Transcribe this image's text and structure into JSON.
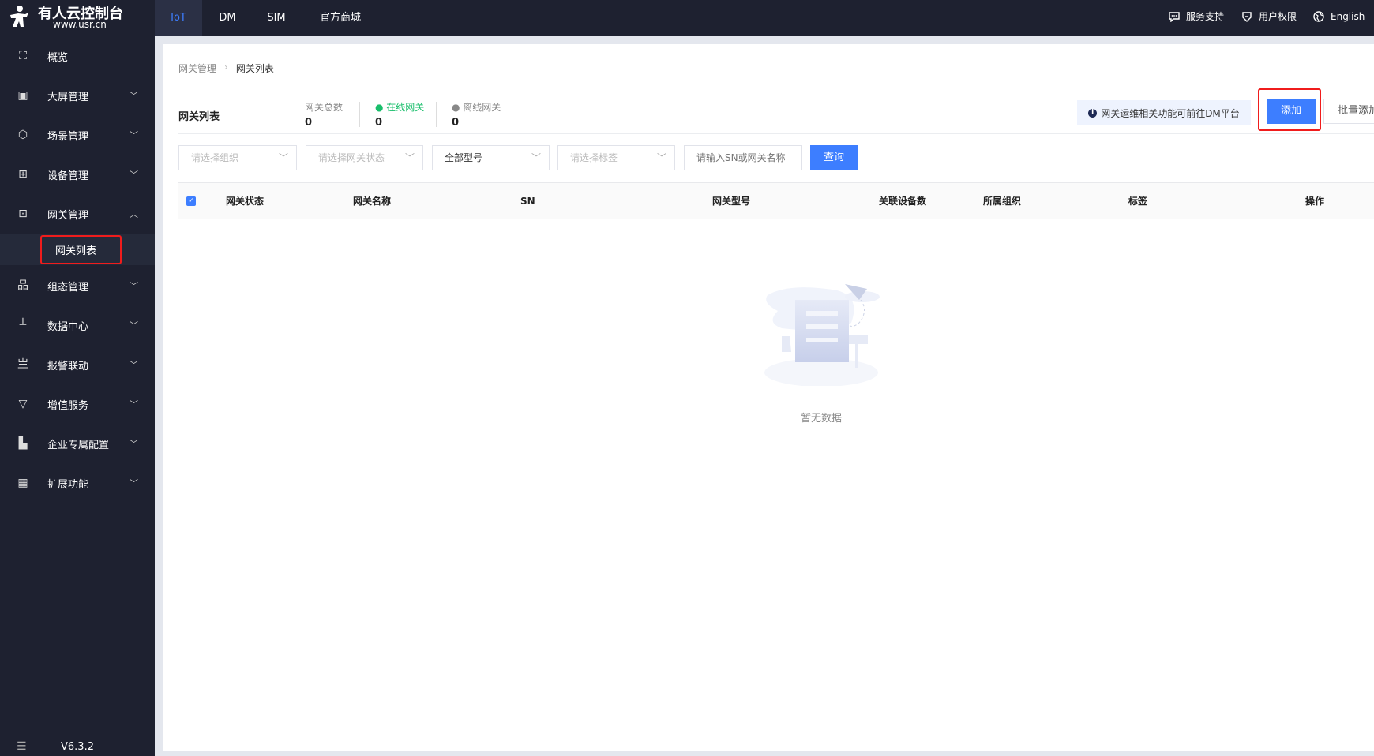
{
  "brand": {
    "title": "有人云控制台",
    "url": "www.usr.cn"
  },
  "top_tabs": [
    {
      "label": "IoT",
      "active": true
    },
    {
      "label": "DM"
    },
    {
      "label": "SIM"
    },
    {
      "label": "官方商城"
    }
  ],
  "header_links": [
    {
      "label": "服务支持",
      "icon": "chat-icon"
    },
    {
      "label": "用户权限",
      "icon": "shield-icon"
    },
    {
      "label": "English",
      "icon": "globe-icon"
    }
  ],
  "sidebar": {
    "items": [
      {
        "label": "概览",
        "icon": "overview-icon"
      },
      {
        "label": "大屏管理",
        "icon": "screen-icon",
        "expandable": true
      },
      {
        "label": "场景管理",
        "icon": "scene-icon",
        "expandable": true
      },
      {
        "label": "设备管理",
        "icon": "device-icon",
        "expandable": true
      },
      {
        "label": "网关管理",
        "icon": "gateway-icon",
        "expandable": true,
        "expanded": true,
        "children": [
          {
            "label": "网关列表",
            "active": true
          }
        ]
      },
      {
        "label": "组态管理",
        "icon": "topology-icon",
        "expandable": true
      },
      {
        "label": "数据中心",
        "icon": "chart-icon",
        "expandable": true
      },
      {
        "label": "报警联动",
        "icon": "alarm-icon",
        "expandable": true
      },
      {
        "label": "增值服务",
        "icon": "diamond-icon",
        "expandable": true
      },
      {
        "label": "企业专属配置",
        "icon": "building-icon",
        "expandable": true
      },
      {
        "label": "扩展功能",
        "icon": "grid-icon",
        "expandable": true
      }
    ],
    "version": "V6.3.2"
  },
  "breadcrumb": [
    "网关管理",
    "网关列表"
  ],
  "page_title": "网关列表",
  "stats": [
    {
      "label": "网关总数",
      "value": "0"
    },
    {
      "label": "在线网关",
      "value": "0",
      "color": "#19be6b"
    },
    {
      "label": "离线网关",
      "value": "0",
      "color": "#999999"
    }
  ],
  "info_banner": "网关运维相关功能可前往DM平台",
  "buttons": {
    "add": "添加",
    "batch_add": "批量添加",
    "query": "查询"
  },
  "filters": {
    "org": "请选择组织",
    "status": "请选择网关状态",
    "model": "全部型号",
    "tag": "请选择标签",
    "search_placeholder": "请输入SN或网关名称"
  },
  "table": {
    "columns": [
      "网关状态",
      "网关名称",
      "SN",
      "网关型号",
      "关联设备数",
      "所属组织",
      "标签",
      "操作"
    ],
    "rows": [],
    "empty_text": "暂无数据"
  },
  "colors": {
    "accent": "#3d7eff",
    "sidebar_bg": "#1e2130",
    "highlight": "#f01c1c"
  }
}
